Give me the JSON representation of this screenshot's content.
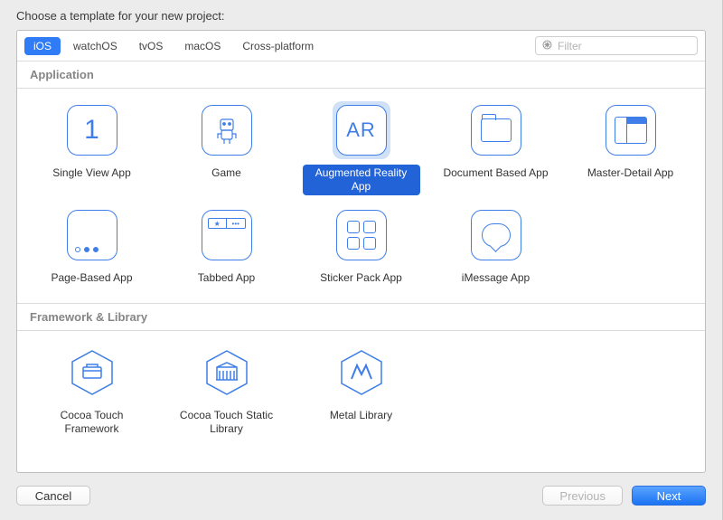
{
  "prompt": "Choose a template for your new project:",
  "tabs": [
    "iOS",
    "watchOS",
    "tvOS",
    "macOS",
    "Cross-platform"
  ],
  "active_tab": 0,
  "filter": {
    "placeholder": "Filter"
  },
  "sections": {
    "application": {
      "title": "Application",
      "items": [
        {
          "id": "single-view",
          "label": "Single View App"
        },
        {
          "id": "game",
          "label": "Game"
        },
        {
          "id": "ar",
          "label": "Augmented Reality App",
          "selected": true
        },
        {
          "id": "document",
          "label": "Document Based App"
        },
        {
          "id": "master-detail",
          "label": "Master-Detail App"
        },
        {
          "id": "page-based",
          "label": "Page-Based App"
        },
        {
          "id": "tabbed",
          "label": "Tabbed App"
        },
        {
          "id": "sticker",
          "label": "Sticker Pack App"
        },
        {
          "id": "imessage",
          "label": "iMessage App"
        }
      ]
    },
    "framework": {
      "title": "Framework & Library",
      "items": [
        {
          "id": "cocoa-touch-framework",
          "label": "Cocoa Touch Framework"
        },
        {
          "id": "cocoa-touch-static",
          "label": "Cocoa Touch Static Library"
        },
        {
          "id": "metal",
          "label": "Metal Library"
        }
      ]
    }
  },
  "buttons": {
    "cancel": "Cancel",
    "previous": "Previous",
    "next": "Next"
  }
}
